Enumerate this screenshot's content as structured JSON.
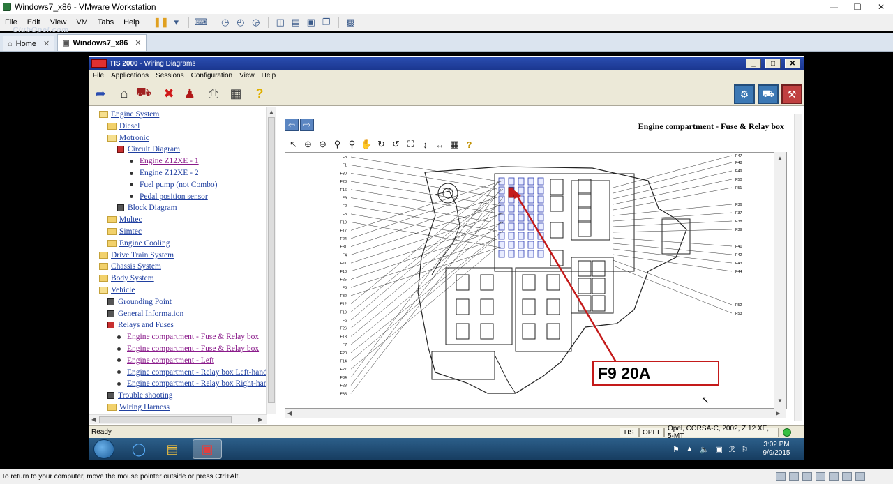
{
  "vmware": {
    "title": "Windows7_x86 - VMware Workstation",
    "menu": [
      "File",
      "Edit",
      "View",
      "VM",
      "Tabs",
      "Help"
    ],
    "watermark": "ClubOpel.com",
    "tabs": [
      {
        "label": "Home"
      },
      {
        "label": "Windows7_x86"
      }
    ],
    "status_text": "To return to your computer, move the mouse pointer outside or press Ctrl+Alt."
  },
  "tis": {
    "title_bold": "TIS 2000",
    "title_rest": " - Wiring Diagrams",
    "menu": [
      "File",
      "Applications",
      "Sessions",
      "Configuration",
      "View",
      "Help"
    ],
    "tree": [
      {
        "label": "Engine System",
        "icon": "folder-open",
        "indent": 0
      },
      {
        "label": "Diesel",
        "icon": "folder",
        "indent": 1
      },
      {
        "label": "Motronic",
        "icon": "folder-open",
        "indent": 1
      },
      {
        "label": "Circuit Diagram",
        "icon": "book-red",
        "indent": 2
      },
      {
        "label": "Engine Z12XE - 1",
        "icon": "bullet",
        "indent": 3,
        "visited": true
      },
      {
        "label": "Engine Z12XE - 2",
        "icon": "bullet",
        "indent": 3
      },
      {
        "label": "Fuel pump (not Combo)",
        "icon": "bullet",
        "indent": 3
      },
      {
        "label": "Pedal position sensor",
        "icon": "bullet",
        "indent": 3
      },
      {
        "label": "Block Diagram",
        "icon": "book",
        "indent": 2
      },
      {
        "label": "Multec",
        "icon": "folder",
        "indent": 1
      },
      {
        "label": "Simtec",
        "icon": "folder",
        "indent": 1
      },
      {
        "label": "Engine Cooling",
        "icon": "folder",
        "indent": 1
      },
      {
        "label": "Drive Train System",
        "icon": "folder",
        "indent": 0
      },
      {
        "label": "Chassis System",
        "icon": "folder",
        "indent": 0
      },
      {
        "label": "Body System",
        "icon": "folder",
        "indent": 0
      },
      {
        "label": "Vehicle",
        "icon": "folder-open",
        "indent": 0
      },
      {
        "label": "Grounding Point",
        "icon": "book",
        "indent": 1
      },
      {
        "label": "General Information",
        "icon": "book",
        "indent": 1
      },
      {
        "label": "Relays and Fuses",
        "icon": "book-red",
        "indent": 1
      },
      {
        "label": "Engine compartment - Fuse & Relay box",
        "icon": "bullet",
        "indent": 2,
        "visited": true
      },
      {
        "label": "Engine compartment - Fuse & Relay box",
        "icon": "bullet",
        "indent": 2,
        "visited": true
      },
      {
        "label": "Engine compartment - Left",
        "icon": "bullet",
        "indent": 2,
        "visited": true
      },
      {
        "label": "Engine compartment - Relay box Left-hand",
        "icon": "bullet",
        "indent": 2
      },
      {
        "label": "Engine compartment - Relay box Right-hand",
        "icon": "bullet",
        "indent": 2
      },
      {
        "label": "Trouble shooting",
        "icon": "book",
        "indent": 1
      },
      {
        "label": "Wiring Harness",
        "icon": "folder",
        "indent": 1
      }
    ],
    "diagram_heading": "Engine compartment - Fuse & Relay box",
    "callout": "F9 20A",
    "fuse_labels_left": [
      "F8",
      "F1",
      "F30",
      "F23",
      "F16",
      "F9",
      "F2",
      "F3",
      "F10",
      "F17",
      "F24",
      "F31",
      "F4",
      "F11",
      "F18",
      "F25",
      "F5",
      "F32",
      "F12",
      "F19",
      "F6",
      "F26",
      "F13",
      "F7",
      "F20",
      "F14",
      "F27",
      "F34",
      "F28",
      "F35"
    ],
    "fuse_labels_right": [
      "F47",
      "F48",
      "F49",
      "F50",
      "F51",
      "F36",
      "F37",
      "F38",
      "F39",
      "F41",
      "F42",
      "F43",
      "F44",
      "F52",
      "F53"
    ],
    "status": {
      "ready": "Ready",
      "tis": "TIS",
      "brand": "OPEL",
      "vehicle": "Opel, CORSA-C, 2002, Z 12 XE, 5-MT"
    }
  },
  "taskbar": {
    "time": "3:02 PM",
    "date": "9/9/2015"
  }
}
